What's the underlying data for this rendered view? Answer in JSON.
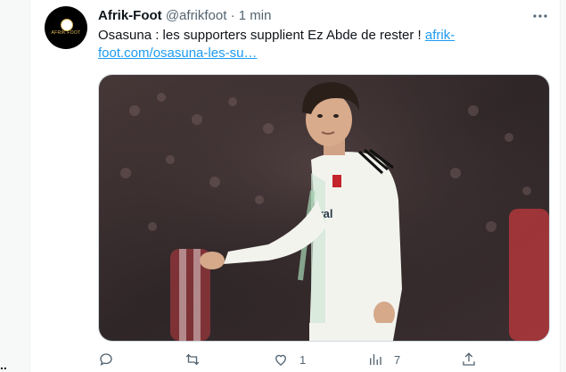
{
  "left_rail": {
    "ellipsis": ".."
  },
  "tweet": {
    "author_name": "Afrik-Foot",
    "author_handle": "@afrikfoot",
    "separator": "·",
    "time": "1 min",
    "avatar_logo_text": "AFRIK FOOT",
    "text": "Osasuna : les supporters supplient Ez Abde de rester ! ",
    "link_text": "afrik-foot.com/osasuna-les-su…",
    "media": {
      "shirt_sponsor": "iral"
    }
  },
  "actions": {
    "reply": {
      "icon": "reply-icon",
      "count": ""
    },
    "retweet": {
      "icon": "retweet-icon",
      "count": ""
    },
    "like": {
      "icon": "heart-icon",
      "count": "1"
    },
    "views": {
      "icon": "views-icon",
      "count": "7"
    },
    "share": {
      "icon": "share-icon",
      "count": ""
    }
  },
  "colors": {
    "link": "#1d9bf0",
    "text": "#0f1419",
    "secondary": "#536471",
    "border": "#cfd9de"
  }
}
